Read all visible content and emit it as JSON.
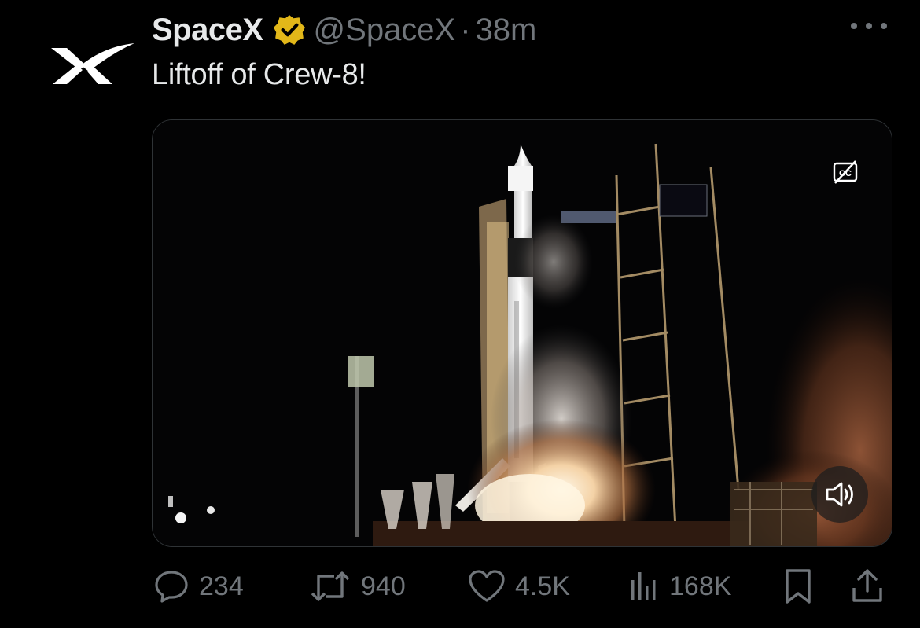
{
  "tweet": {
    "author_name": "SpaceX",
    "handle": "@SpaceX",
    "separator": "·",
    "time": "38m",
    "text": "Liftoff of Crew-8!",
    "verified_badge_color": "#e2b719",
    "avatar_icon": "spacex-x-logo-icon"
  },
  "media": {
    "type": "video",
    "captions_icon": "closed-captions-off-icon",
    "sound_icon": "speaker-sound-icon"
  },
  "actions": {
    "replies": "234",
    "reposts": "940",
    "likes": "4.5K",
    "views": "168K",
    "bookmark_icon": "bookmark-icon",
    "share_icon": "share-icon"
  },
  "colors": {
    "background": "#000000",
    "primary_text": "#e7e9ea",
    "secondary_text": "#71767b"
  }
}
